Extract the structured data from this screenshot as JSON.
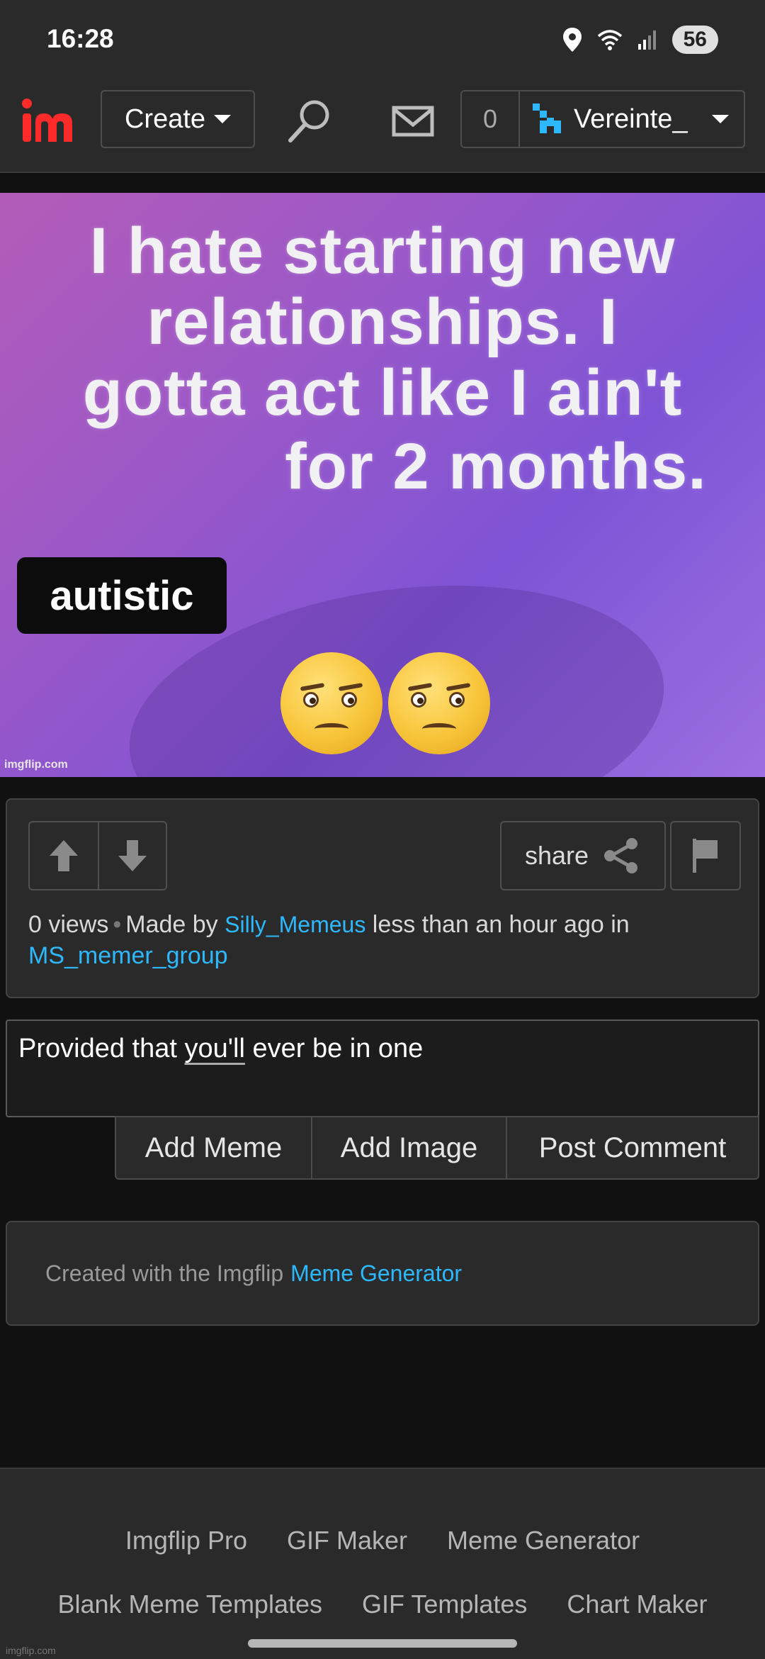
{
  "status_bar": {
    "time": "16:28",
    "battery": "56",
    "wifi_label": "6"
  },
  "header": {
    "logo": "im",
    "create_label": "Create",
    "notification_count": "0",
    "username": "Vereinte_"
  },
  "meme": {
    "lines": [
      "I hate starting new",
      "relationships. I",
      "gotta act like I ain't"
    ],
    "badge_text": "autistic",
    "last_line": "for 2 months.",
    "watermark": "imgflip.com"
  },
  "post": {
    "share_label": "share",
    "views": "0 views",
    "made_by": "Made by",
    "author": "Silly_Memeus",
    "time_text": "less than an hour ago in",
    "group": "MS_memer_group"
  },
  "comment": {
    "text_before": "Provided that ",
    "text_underlined": "you'll",
    "text_after": " ever be in one",
    "buttons": [
      "Add Meme",
      "Add Image",
      "Post Comment"
    ]
  },
  "credit": {
    "text": "Created with the Imgflip",
    "link": "Meme Generator"
  },
  "footer": {
    "row1": [
      "Imgflip Pro",
      "GIF Maker",
      "Meme Generator"
    ],
    "row2": [
      "Blank Meme Templates",
      "GIF Templates",
      "Chart Maker"
    ],
    "watermark": "imgflip.com"
  },
  "colors": {
    "accent": "#2db8ff",
    "brand": "#ff2a2a",
    "background": "#111111",
    "panel": "#2a2a2a"
  }
}
